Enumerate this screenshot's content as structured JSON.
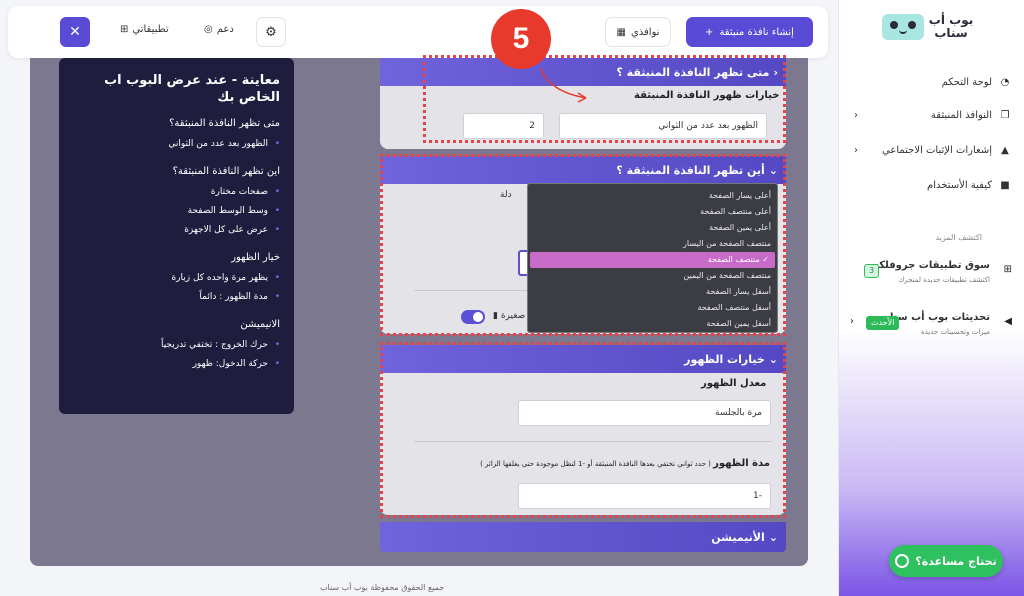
{
  "sidebar": {
    "logo_text": "بوب أب سناب",
    "items": [
      {
        "label": "لوحة التحكم",
        "icon": "dashboard-icon"
      },
      {
        "label": "النوافذ المنبثقة",
        "icon": "windows-icon"
      },
      {
        "label": "إشعارات الإثبات الاجتماعي",
        "icon": "bell-icon"
      },
      {
        "label": "كيفية الأستخدام",
        "icon": "video-icon"
      }
    ],
    "section_label": "اكتشف المزيد",
    "promos": [
      {
        "title": "سوق تطبيقات جروفلكس",
        "subtitle": "اكتشف تطبيقات جديدة لمتجرك",
        "badge": "3"
      },
      {
        "title": "تحديثات بوب أب سناب",
        "subtitle": "ميزات وتحسينات جديدة",
        "badge": "الأحدث"
      }
    ],
    "help_label": "تحتاج مساعدة؟"
  },
  "topbar": {
    "create_label": "إنشاء نافذة منبثقة",
    "windows_label": "نوافذي",
    "support_label": "دعم",
    "apps_label": "تطبيقاتي"
  },
  "step_number": "5",
  "preview": {
    "title": "معاينة - عند عرض البوب اب الخاص بك",
    "sections": [
      {
        "heading": "متى تظهر النافذة المنبثقة؟",
        "items": [
          "الظهور بعد عدد من الثواني"
        ]
      },
      {
        "heading": "اين تظهر النافذة المنبثقة؟",
        "items": [
          "صفحات مختارة",
          "وسط الوسط الصفحة",
          "عرض على كل الاجهزة"
        ]
      },
      {
        "heading": "خيار الظهور",
        "items": [
          "يظهر مرة واحده كل زيارة",
          "مدة الظهور : دائماً"
        ]
      },
      {
        "heading": "الانيميشن",
        "items": [
          "حرك الخروج : تختفي تدريجياً",
          "حركة الدخول: ظهور"
        ]
      }
    ]
  },
  "panel_when": {
    "header": "متى تظهر النافذة المنبثقة ؟",
    "label": "خيارات ظهور النافذة المنبثقة",
    "select_value": "الظهور بعد عدد من الثواني",
    "seconds_value": "2"
  },
  "panel_where": {
    "header": "أين تظهر النافذة المنبثقة ؟",
    "partial_text": "دلة",
    "toggle_label": "صغيرة",
    "dropdown_options": [
      "أعلى يسار الصفحة",
      "أعلى منتصف الصفحة",
      "أعلى يمين الصفحة",
      "منتصف الصفحة من اليسار",
      "منتصف الصفحة",
      "منتصف الصفحة من اليمين",
      "أسفل يسار الصفحة",
      "أسفل منتصف الصفحة",
      "أسفل يمين الصفحة"
    ],
    "selected_index": 4
  },
  "panel_display": {
    "header": "خيارات الظهور",
    "rate_label": "معدل الظهور",
    "rate_value": "مرة بالجلسة",
    "duration_label": "مدة الظهور",
    "duration_hint": "( حدد ثواني تختفي بعدها النافذة المنبثقة أو -1 لتظل موجودة حتى يغلقها الزائر )",
    "duration_value": "-1"
  },
  "panel_animation": {
    "header": "الأنيميشن"
  },
  "footer": "جميع الحقوق محفوظة بوب أب سناب"
}
